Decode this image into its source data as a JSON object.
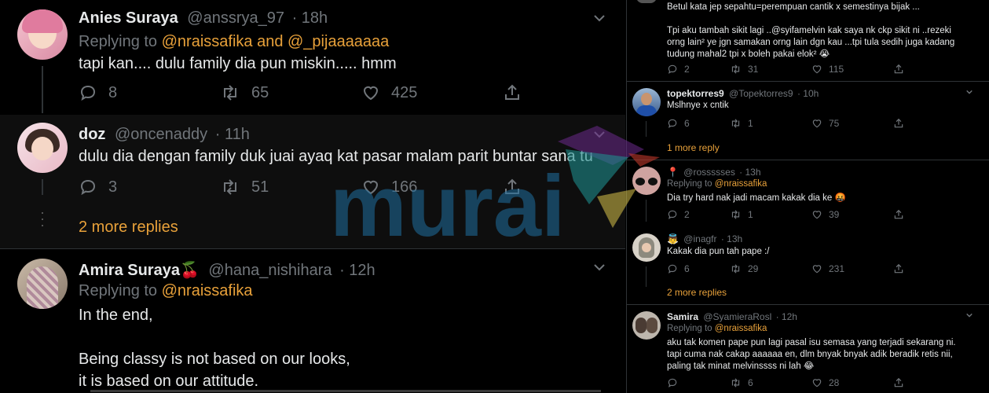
{
  "left": {
    "tweets": [
      {
        "name": "Anies Suraya",
        "handle": "@anssrya_97",
        "time": "· 18h",
        "replying_prefix": "Replying to",
        "replying_users": "@nraissafika and @_pijaaaaaaa",
        "text": "tapi kan.... dulu family dia pun miskin..... hmm",
        "replies": "8",
        "retweets": "65",
        "likes": "425"
      },
      {
        "name": "doz",
        "handle": "@oncenaddy",
        "time": "· 11h",
        "text": "dulu dia dengan family duk juai ayaq kat pasar malam parit buntar sana tu",
        "replies": "3",
        "retweets": "51",
        "likes": "166"
      },
      {
        "name": "Amira Suraya🍒",
        "handle": "@hana_nishihara",
        "time": "· 12h",
        "replying_prefix": "Replying to",
        "replying_users": "@nraissafika",
        "text_lines": [
          "In the end,",
          "",
          "Being classy is not based on our looks,",
          "it is based on our attitude."
        ]
      }
    ],
    "more_replies": "2 more replies"
  },
  "right": {
    "top_tweet": {
      "lines": [
        "Betul kata jep sepahtu=perempuan cantik x semestinya bijak ...",
        "",
        "Tpi aku tambah sikit lagi ..@syifamelvin  kak saya nk ckp sikit ni ..rezeki",
        "orng lain² ye jgn samakan  orng  lain dgn kau ...tpi tula sedih juga kadang",
        "tudung mahal2 tpi x boleh pakai elok² 😭"
      ],
      "replies": "2",
      "retweets": "31",
      "likes": "115"
    },
    "replies": [
      {
        "name": "topektorres9",
        "handle": "@Topektorres9",
        "time": "· 10h",
        "text": "Mslhnye x cntik",
        "replies": "6",
        "retweets": "1",
        "likes": "75"
      },
      {
        "name": "📍",
        "handle": "@rossssses",
        "time": "· 13h",
        "replying_prefix": "Replying to",
        "replying_users": "@nraissafika",
        "text": "Dia try hard nak jadi macam kakak dia ke 🤬",
        "replies": "2",
        "retweets": "1",
        "likes": "39"
      },
      {
        "name": "👼",
        "handle": "@inagfr",
        "time": "· 13h",
        "text": "Kakak dia pun tah pape :/",
        "replies": "6",
        "retweets": "29",
        "likes": "231"
      },
      {
        "name": "Samira",
        "handle": "@SyamieraRosl",
        "time": "· 12h",
        "replying_prefix": "Replying to",
        "replying_users": "@nraissafika",
        "lines": [
          "aku tak komen pape pun lagi pasal isu semasa yang terjadi sekarang ni.",
          "tapi cuma nak cakap aaaaaa en, dlm bnyak bnyak adik beradik retis nii,",
          "paling tak minat melvinssss ni lah 😂"
        ],
        "replies": "",
        "retweets": "6",
        "likes": "28"
      }
    ],
    "more_reply_1": "1 more reply",
    "more_replies_2": "2 more replies"
  },
  "watermark": {
    "text": "murai"
  },
  "colors": {
    "accent": "#e8a13a",
    "muted": "#71767b",
    "divider": "#2f3336",
    "bg": "#000000"
  }
}
